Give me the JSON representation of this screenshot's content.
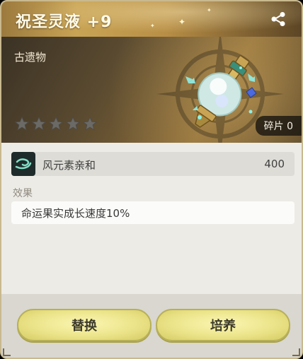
{
  "title": "祝圣灵液 +9",
  "category": "古遗物",
  "rarity_stars": 5,
  "filled_stars": 0,
  "fragments_text": "碎片 0",
  "stat": {
    "name": "风元素亲和",
    "value": "400",
    "icon": "wind-element-icon"
  },
  "effect": {
    "label": "效果",
    "text": "命运果实成长速度10%"
  },
  "buttons": {
    "replace_label": "替换",
    "cultivate_label": "培养"
  },
  "colors": {
    "title_gold": "#c9a455",
    "button_yellow": "#ece48a",
    "banner_dark": "#3b3225",
    "panel_bg": "#ecebe6"
  }
}
